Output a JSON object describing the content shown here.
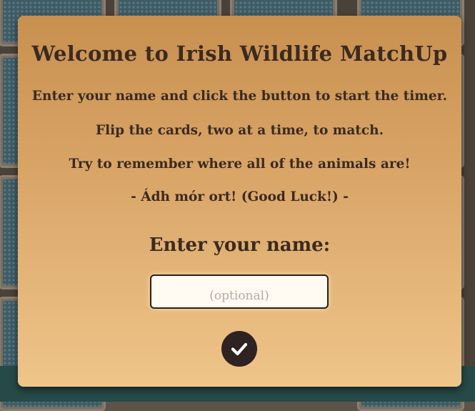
{
  "modal": {
    "title": "Welcome to Irish Wildlife MatchUp",
    "instructions": [
      "Enter your name and click the button to start the timer.",
      "Flip the cards, two at a time, to match.",
      "Try to remember where all of the animals are!",
      "- Ádh mór ort! (Good Luck!) -"
    ],
    "name_label": "Enter your name:",
    "name_input": {
      "value": "",
      "placeholder": "(optional)"
    },
    "confirm_button": {
      "icon": "checkmark-icon"
    }
  },
  "colors": {
    "modal_top": "#c8904f",
    "modal_bottom": "#efc58a",
    "text": "#3b2a20",
    "button_bg": "#2f2222",
    "card_back": "#3f5c66"
  }
}
